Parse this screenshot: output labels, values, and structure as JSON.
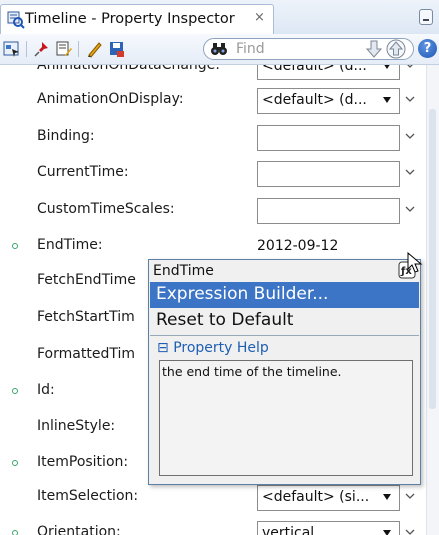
{
  "tab": {
    "title": "Timeline - Property Inspector",
    "close_symbol": "×"
  },
  "toolbar": {
    "icons": [
      "select-element-icon",
      "pin-icon",
      "edit-properties-icon",
      "pencil-icon",
      "save-icon"
    ],
    "find_placeholder": "Find",
    "help_label": "?"
  },
  "properties": [
    {
      "label": "AnimationOnDataChange:",
      "value": "<default> (d...",
      "control": "dropdown",
      "modified": false
    },
    {
      "label": "AnimationOnDisplay:",
      "value": "<default> (d...",
      "control": "dropdown",
      "modified": false
    },
    {
      "label": "Binding:",
      "value": "",
      "control": "text",
      "modified": false
    },
    {
      "label": "CurrentTime:",
      "value": "",
      "control": "text",
      "modified": false
    },
    {
      "label": "CustomTimeScales:",
      "value": "",
      "control": "text",
      "modified": false
    },
    {
      "label": "EndTime:",
      "value": "2012-09-12",
      "control": "text",
      "modified": true
    },
    {
      "label": "FetchEndTime",
      "value": "",
      "control": "none",
      "modified": false
    },
    {
      "label": "FetchStartTim",
      "value": "",
      "control": "none",
      "modified": false
    },
    {
      "label": "FormattedTim",
      "value": "",
      "control": "none",
      "modified": false
    },
    {
      "label": "Id:",
      "value": "",
      "control": "none",
      "modified": true
    },
    {
      "label": "InlineStyle:",
      "value": "",
      "control": "none",
      "modified": false
    },
    {
      "label": "ItemPosition:",
      "value": "",
      "control": "none",
      "modified": true
    },
    {
      "label": "ItemSelection:",
      "value": "<default> (si...",
      "control": "dropdown",
      "modified": false
    },
    {
      "label": "Orientation:",
      "value": "vertical",
      "control": "dropdown",
      "modified": true
    }
  ],
  "popup": {
    "title": "EndTime",
    "items": [
      "Expression Builder...",
      "Reset to Default"
    ],
    "help_heading": "Property Help",
    "help_collapse_symbol": "⊟",
    "help_text": "the end time of the timeline."
  },
  "colors": {
    "accent": "#3d75c6",
    "modified_dot": "#3aa36b",
    "help_link": "#1e5fb3"
  }
}
